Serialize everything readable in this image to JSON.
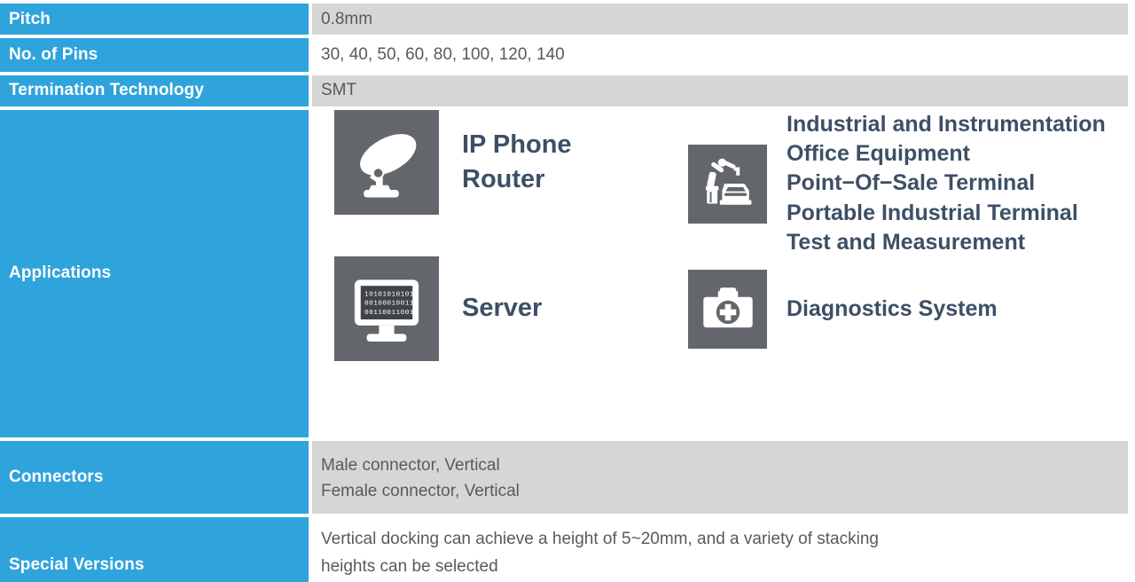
{
  "table": {
    "rows": [
      {
        "label": "Pitch",
        "value": "0.8mm"
      },
      {
        "label": "No. of Pins",
        "value": "30, 40, 50, 60, 80, 100, 120, 140"
      },
      {
        "label": "Termination Technology",
        "value": "SMT"
      }
    ],
    "applications": {
      "label": "Applications",
      "items": [
        {
          "icon": "satellite-dish-icon",
          "text": "IP Phone\nRouter"
        },
        {
          "icon": "industrial-robot-arm-icon",
          "text": "Industrial and Instrumentation\nOffice Equipment\nPoint−Of−Sale Terminal\nPortable Industrial Terminal\nTest and Measurement"
        },
        {
          "icon": "server-monitor-icon",
          "text": "Server"
        },
        {
          "icon": "first-aid-kit-icon",
          "text": "Diagnostics System"
        }
      ]
    },
    "connectors": {
      "label": "Connectors",
      "value": "Male connector, Vertical\nFemale connector, Vertical"
    },
    "special_versions": {
      "label": "Special Versions",
      "value": "Vertical docking can achieve a height of 5~20mm, and a variety of stacking\nheights can be selected"
    }
  },
  "colors": {
    "label_blue": "#2fa3dc",
    "value_gray": "#d6d6d6",
    "icon_box_gray": "#63666a",
    "app_text_navy": "#3d4f66",
    "value_text": "#5a5a5a"
  }
}
